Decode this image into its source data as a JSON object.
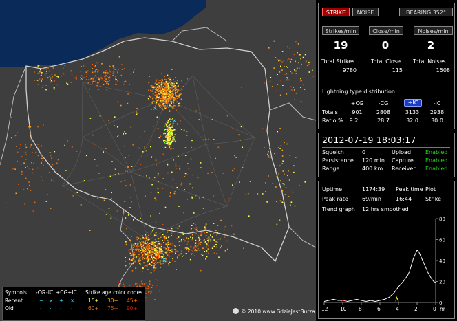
{
  "map": {
    "copyright": "© 2010 www.GdzieJestBurza.pl",
    "legend": {
      "symbols_label": "Symbols",
      "recent_label": "Recent",
      "old_label": "Old",
      "headers": [
        "-CG",
        "-IC",
        "+CG",
        "+IC"
      ],
      "recent_symbols": [
        "−",
        "×",
        "+",
        "×"
      ],
      "old_symbols": [
        ".",
        ".",
        ".",
        "."
      ],
      "age_title": "Strike age color codes",
      "recent_ages": [
        "15+",
        "30+",
        "45+"
      ],
      "old_ages": [
        "60+",
        "75+",
        "90+"
      ],
      "age_colors": [
        "#ffff40",
        "#ffa020",
        "#ff6a00",
        "#e07010",
        "#d05010",
        "#c02010"
      ]
    }
  },
  "top_buttons": {
    "strike": "STRIKE",
    "noise": "NOISE",
    "bearing": "BEARING 352°"
  },
  "rates": {
    "strikes_label": "Strikes/min",
    "close_label": "Close/min",
    "noises_label": "Noises/min",
    "strikes_value": "19",
    "close_value": "0",
    "noises_value": "2"
  },
  "totals": {
    "strikes_label": "Total Strikes",
    "close_label": "Total Close",
    "noises_label": "Total Noises",
    "strikes_value": "9780",
    "close_value": "115",
    "noises_value": "1508"
  },
  "distribution": {
    "title": "Lightning type distribution",
    "headers": [
      "+CG",
      "-CG",
      "+IC",
      "-IC"
    ],
    "totals_label": "Totals",
    "ratio_label": "Ratio %",
    "totals": [
      "901",
      "2808",
      "3133",
      "2938"
    ],
    "ratios": [
      "9.2",
      "28.7",
      "32.0",
      "30.0"
    ]
  },
  "status": {
    "datetime": "2012-07-19 18:03:17",
    "squelch_label": "Squelch",
    "squelch_value": "0",
    "persistence_label": "Persistence",
    "persistence_value": "120 min",
    "range_label": "Range",
    "range_value": "400 km",
    "upload_label": "Upload",
    "upload_value": "Enabled",
    "capture_label": "Capture",
    "capture_value": "Enabled",
    "receiver_label": "Receiver",
    "receiver_value": "Enabled"
  },
  "stats": {
    "uptime_label": "Uptime",
    "uptime_value": "1174:39",
    "peaktime_label": "Peak time",
    "peaktime_value": "16:44",
    "peakrate_label": "Peak rate",
    "peakrate_value": "69/min",
    "plot_label": "Plot",
    "plot_value": "Strike",
    "trend_label": "Trend graph",
    "trend_value": "12 hrs smoothed"
  },
  "chart_data": {
    "type": "line",
    "x_unit_label": "hr",
    "x_ticks": [
      "12",
      "10",
      "8",
      "6",
      "4",
      "2",
      "0"
    ],
    "y_ticks": [
      "0",
      "20",
      "40",
      "60",
      "80"
    ],
    "ylim": [
      0,
      80
    ],
    "xlim": [
      12,
      0
    ],
    "series": [
      {
        "color": "#ffffff",
        "x": [
          12,
          11.5,
          11,
          10.5,
          10,
          9.5,
          9,
          8.5,
          8,
          7.5,
          7,
          6.5,
          6,
          5.5,
          5,
          4.5,
          4,
          3.5,
          3,
          2.8,
          2.6,
          2.4,
          2.2,
          2,
          1.8,
          1.6,
          1.4,
          1.2,
          1,
          0.8,
          0.6,
          0.4,
          0.2,
          0
        ],
        "y": [
          1,
          2,
          3,
          2,
          2,
          1,
          2,
          3,
          2,
          1,
          2,
          1,
          2,
          3,
          5,
          9,
          15,
          20,
          26,
          30,
          36,
          42,
          46,
          50,
          48,
          44,
          40,
          36,
          32,
          28,
          25,
          22,
          20,
          19
        ]
      },
      {
        "color": "#ff4040",
        "x": [
          10.2,
          10,
          9.8,
          9.6
        ],
        "y": [
          1,
          2,
          2,
          1
        ]
      },
      {
        "color": "#ffff00",
        "x": [
          4.3,
          4.2,
          4.1,
          4
        ],
        "y": [
          1,
          5,
          3,
          1
        ]
      }
    ]
  }
}
